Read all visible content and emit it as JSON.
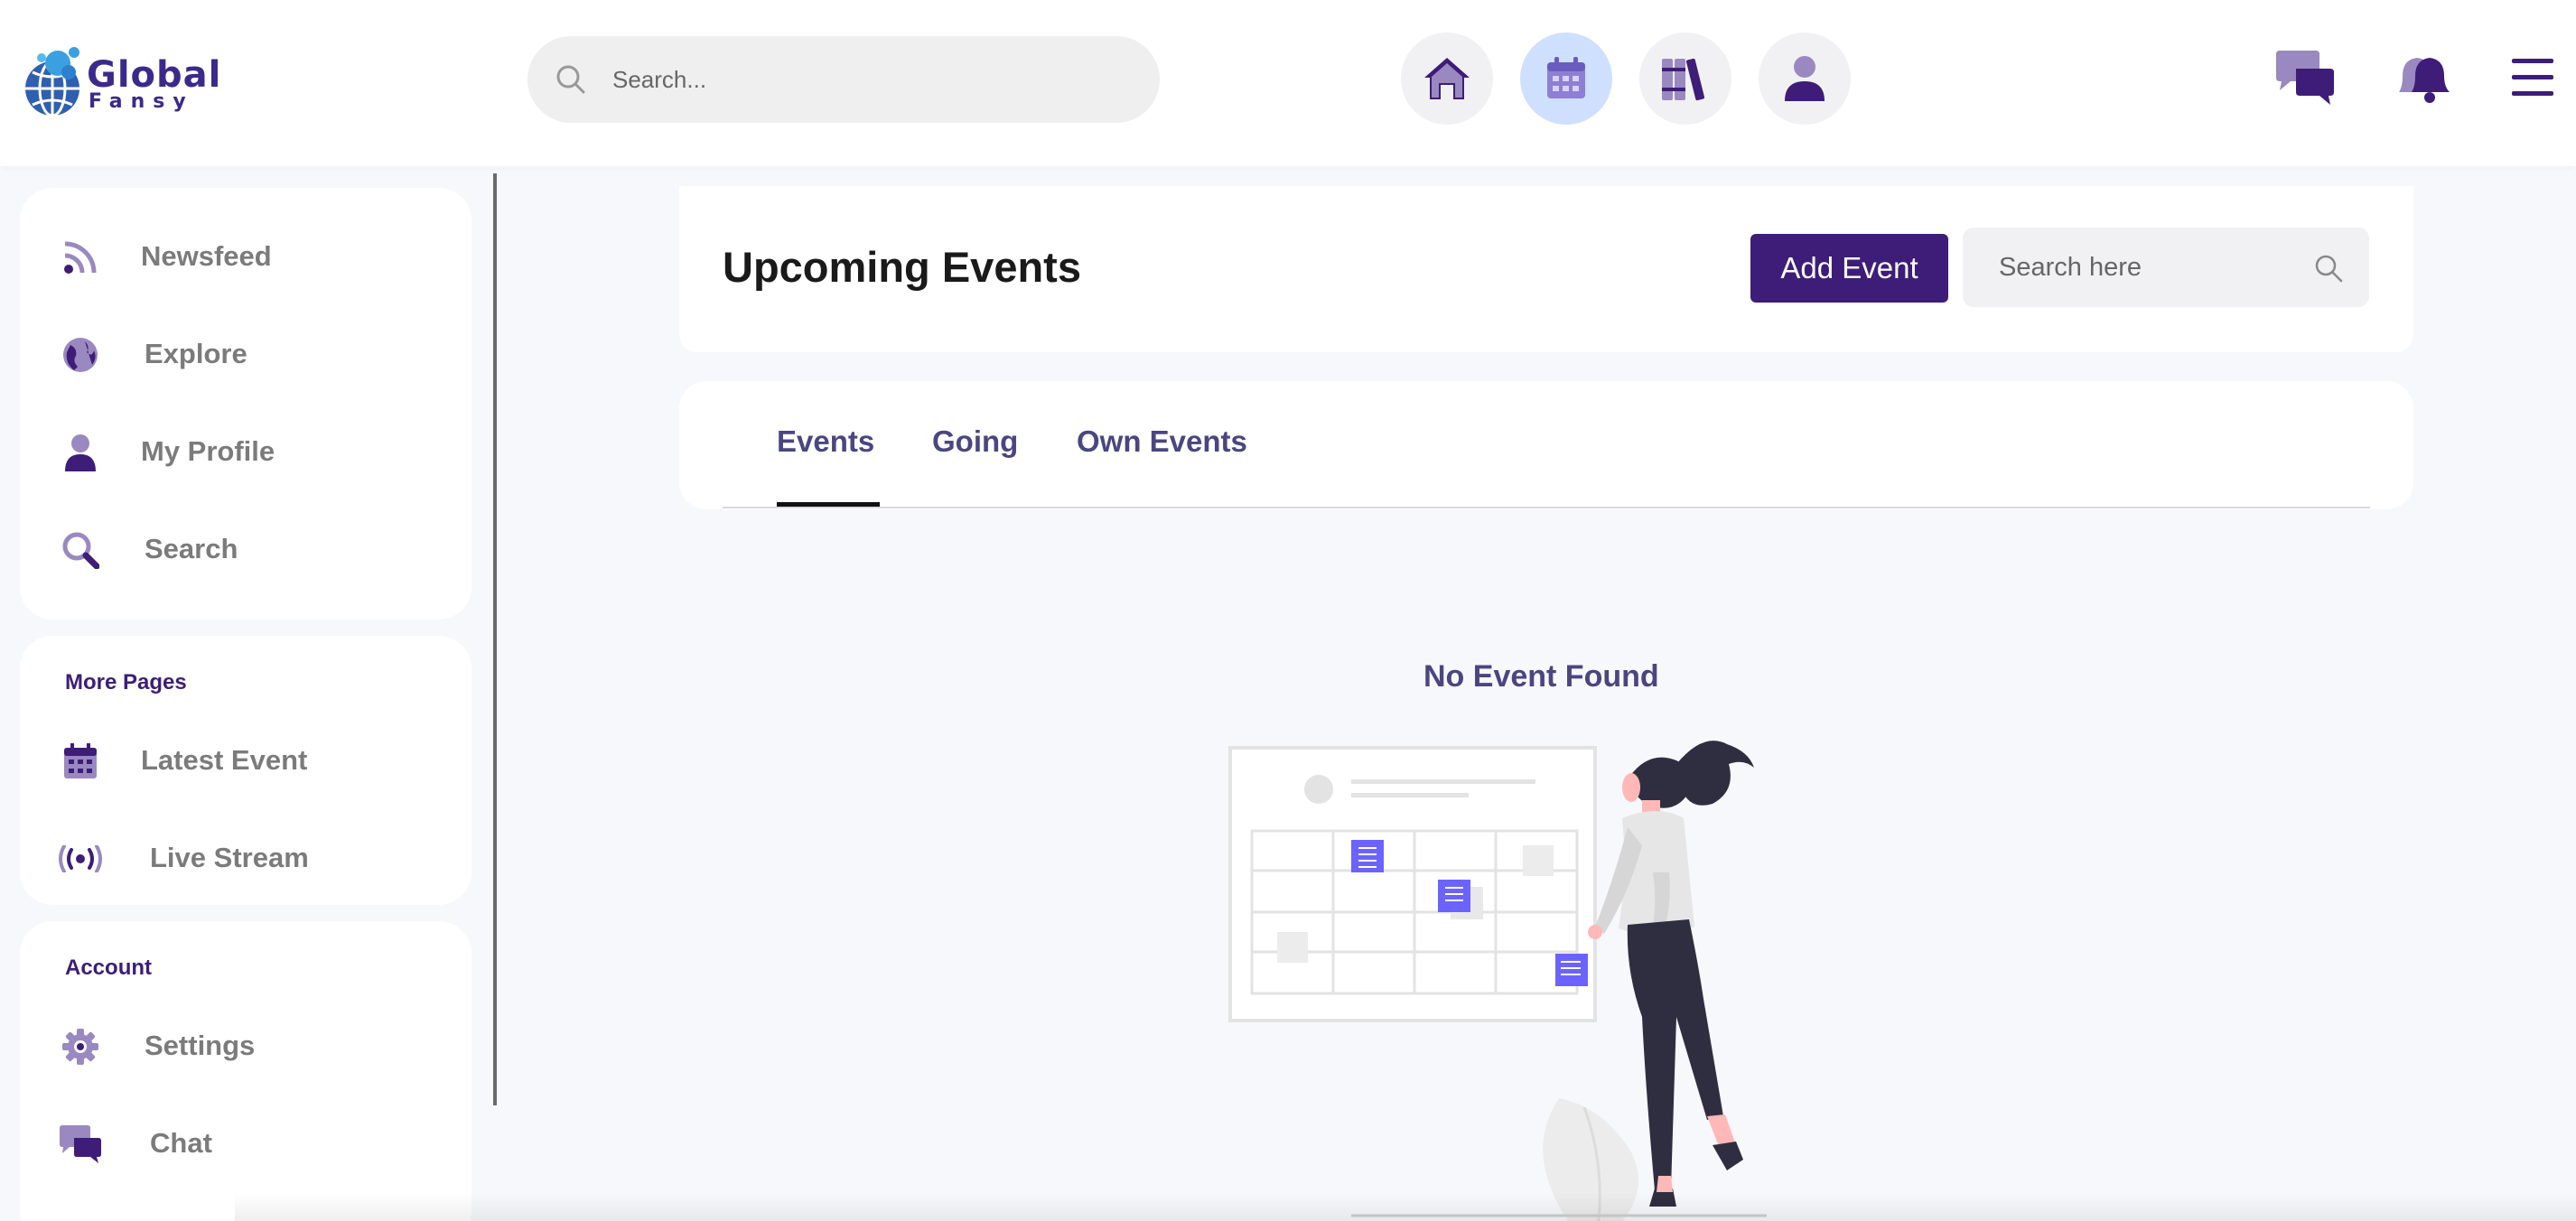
{
  "header": {
    "logo_line1": "Global",
    "logo_line2": "Fansy",
    "search_placeholder": "Search...",
    "nav_icons": [
      "home-icon",
      "calendar-icon",
      "library-icon",
      "user-icon"
    ],
    "active_nav": "calendar-icon",
    "right_icons": [
      "chat-icon",
      "bell-icon",
      "menu-icon"
    ]
  },
  "sidebar": {
    "main_items": [
      {
        "label": "Newsfeed",
        "icon": "rss-icon"
      },
      {
        "label": "Explore",
        "icon": "globe-icon"
      },
      {
        "label": "My Profile",
        "icon": "user-icon"
      },
      {
        "label": "Search",
        "icon": "search-icon"
      }
    ],
    "more_pages_title": "More Pages",
    "more_items": [
      {
        "label": "Latest Event",
        "icon": "calendar-icon"
      },
      {
        "label": "Live Stream",
        "icon": "broadcast-icon"
      }
    ],
    "account_title": "Account",
    "account_items": [
      {
        "label": "Settings",
        "icon": "gear-icon"
      },
      {
        "label": "Chat",
        "icon": "chat-icon"
      }
    ]
  },
  "main": {
    "title": "Upcoming Events",
    "add_button": "Add Event",
    "search_placeholder": "Search here",
    "tabs": [
      "Events",
      "Going",
      "Own Events"
    ],
    "active_tab": "Events",
    "empty_message": "No Event Found"
  },
  "colors": {
    "brand": "#3d1d78",
    "icon_purple": "#3d1d78",
    "icon_light": "#9a89c0",
    "tab_text": "#4a4680",
    "note_blue": "#6c63ff",
    "active_nav_bg": "#cfe0ff"
  }
}
